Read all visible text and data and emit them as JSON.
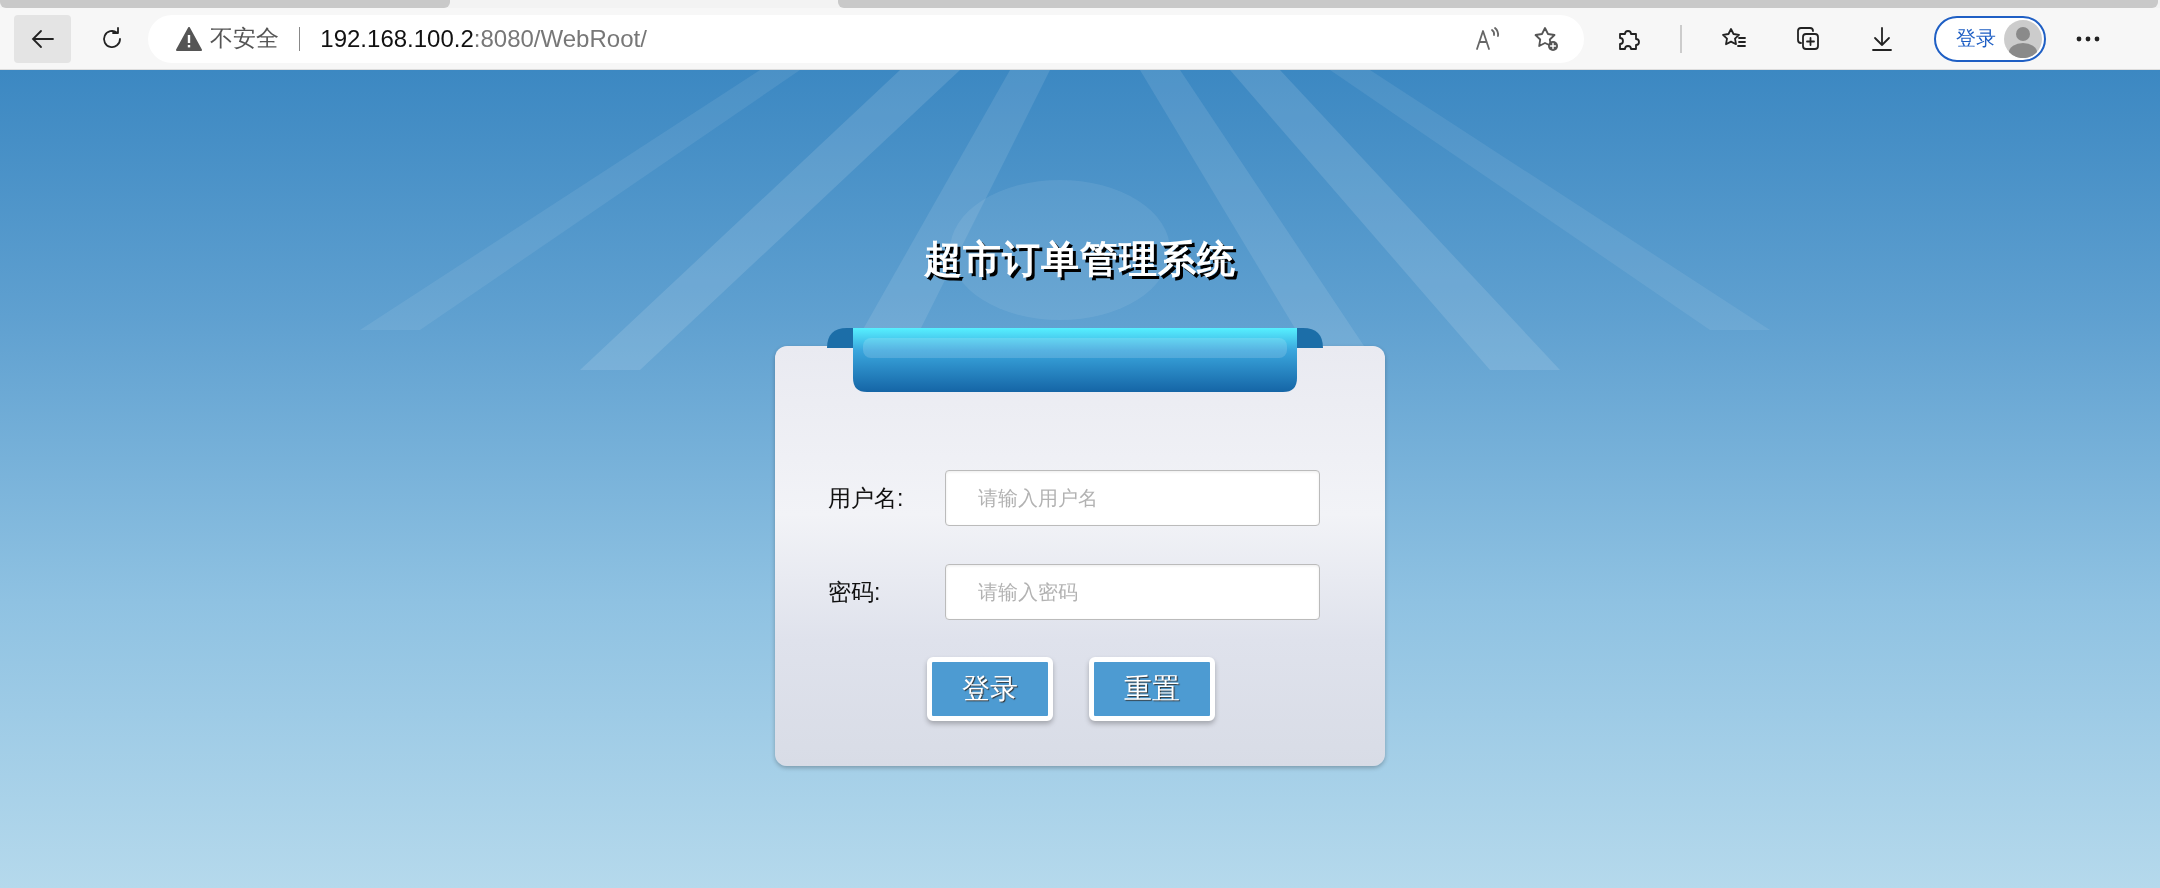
{
  "browser": {
    "security_label": "不安全",
    "url_host": "192.168.100.2",
    "url_rest": ":8080/WebRoot/",
    "profile_label": "登录"
  },
  "page": {
    "title": "超市订单管理系统",
    "fields": [
      {
        "label": "用户名:",
        "placeholder": "请输入用户名"
      },
      {
        "label": "密码:",
        "placeholder": "请输入密码"
      }
    ],
    "buttons": [
      "登录",
      "重置"
    ]
  }
}
